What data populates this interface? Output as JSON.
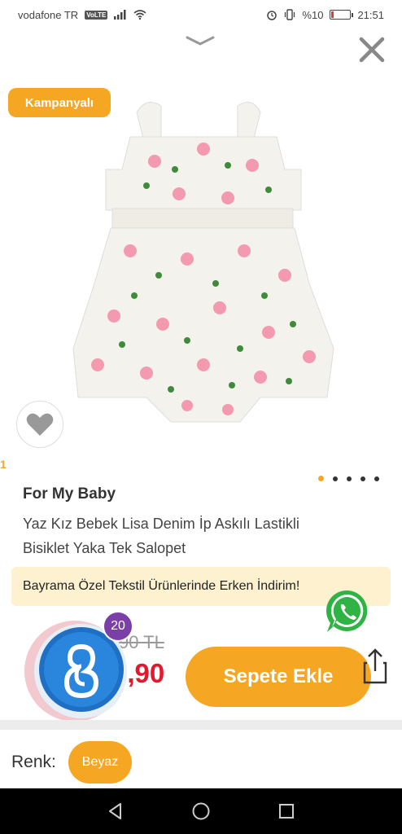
{
  "status_bar": {
    "carrier": "vodafone TR",
    "volte": "VoLTE",
    "battery_text": "%10",
    "time": "21:51"
  },
  "product": {
    "campaign_badge": "Kampanyalı",
    "brand": "For My Baby",
    "name_line1": "Yaz Kız Bebek Lisa Denim İp Askılı Lastikli",
    "name_line2": "Bisiklet Yaka Tek Salopet",
    "image_pages": 5,
    "active_page": 1,
    "edge_mark": "1"
  },
  "promo": {
    "text": "Bayrama Özel Tekstil Ürünlerinde Erken İndirim!"
  },
  "price": {
    "old": "90 TL",
    "new": "9,90"
  },
  "assistant": {
    "badge_count": "20"
  },
  "actions": {
    "add_to_cart": "Sepete Ekle"
  },
  "variant": {
    "label": "Renk:",
    "selected_color": "Beyaz"
  },
  "colors": {
    "accent": "#f5a623",
    "price_red": "#e3182d",
    "badge_purple": "#7b3fa8",
    "banner_bg": "#fdf1cf"
  }
}
